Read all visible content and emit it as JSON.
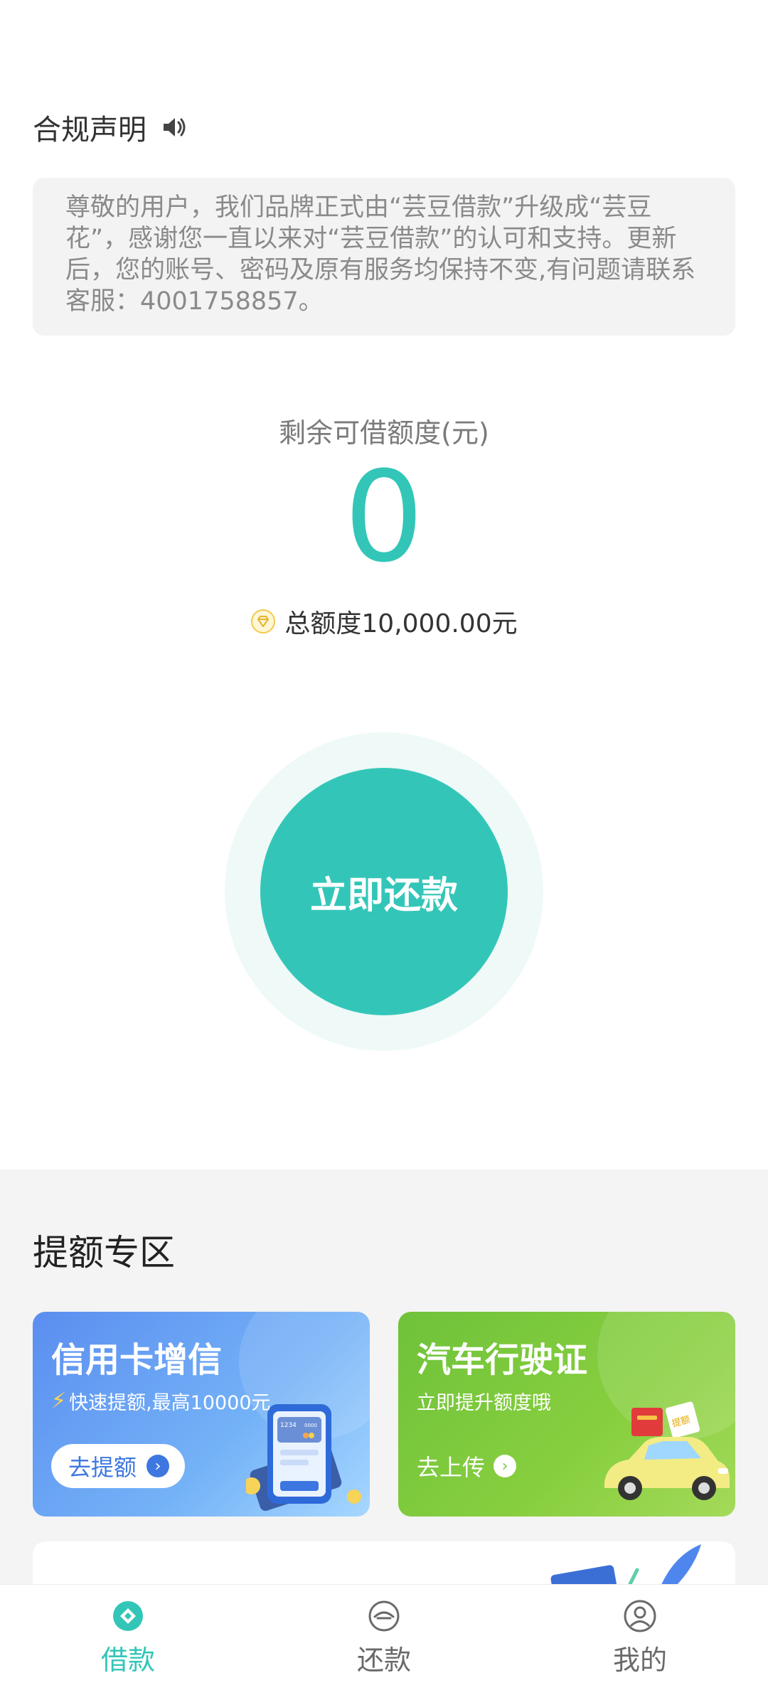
{
  "compliance": {
    "title": "合规声明",
    "notice": "尊敬的用户，我们品牌正式由“芸豆借款”升级成“芸豆花”，感谢您一直以来对“芸豆借款”的认可和支持。更新后，您的账号、密码及原有服务均保持不变,有问题请联系客服：4001758857。"
  },
  "credit": {
    "label": "剩余可借额度(元)",
    "remaining": "0",
    "total_text": "总额度10,000.00元"
  },
  "repay_button": "立即还款",
  "zone": {
    "title": "提额专区",
    "cards": [
      {
        "title": "信用卡增信",
        "subtitle": "快速提额,最高10000元",
        "button": "去提额",
        "illus_card_number": "1234",
        "illus_card_code": "0000"
      },
      {
        "title": "汽车行驶证",
        "subtitle": "立即提升额度哦",
        "button": "去上传",
        "illus_tag": "提额"
      }
    ]
  },
  "nav": {
    "items": [
      {
        "label": "借款",
        "icon": "loan-icon",
        "active": true
      },
      {
        "label": "还款",
        "icon": "repay-icon",
        "active": false
      },
      {
        "label": "我的",
        "icon": "profile-icon",
        "active": false
      }
    ]
  },
  "colors": {
    "accent": "#33c6b8",
    "blue_card": "#5b8ef0",
    "green_card": "#7cc83c"
  }
}
